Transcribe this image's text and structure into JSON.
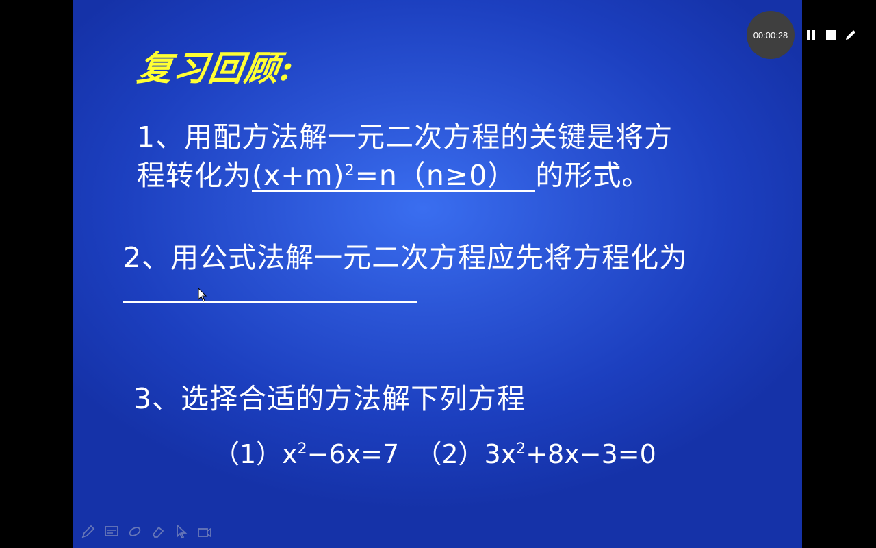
{
  "slide": {
    "title": "复习回顾:",
    "q1_line1": "1、用配方法解一元二次方程的关键是将方",
    "q1_line2_prefix": "程转化为",
    "q1_answer_a": "(x+m)",
    "q1_answer_sup": "2",
    "q1_answer_b": "=n（n≥0）",
    "q1_line2_suffix": "的形式。",
    "q2_line": "2、用公式法解一元二次方程应先将方程化为",
    "q3_line": "3、选择合适的方法解下列方程",
    "eq1_prefix": "（1）x",
    "eq1_sup": "2",
    "eq1_suffix": "−6x=7",
    "eq2_prefix": "（2）3x",
    "eq2_sup": "2",
    "eq2_suffix": "+8x−3=0"
  },
  "recorder": {
    "timer": "00:00:28",
    "pause_icon": "pause-icon",
    "stop_icon": "stop-icon",
    "pen_icon": "pen-icon"
  },
  "bottom_toolbar": {
    "icons": [
      "pen-icon",
      "screen-icon",
      "highlighter-icon",
      "eraser-icon",
      "pointer-icon",
      "camera-icon"
    ]
  }
}
